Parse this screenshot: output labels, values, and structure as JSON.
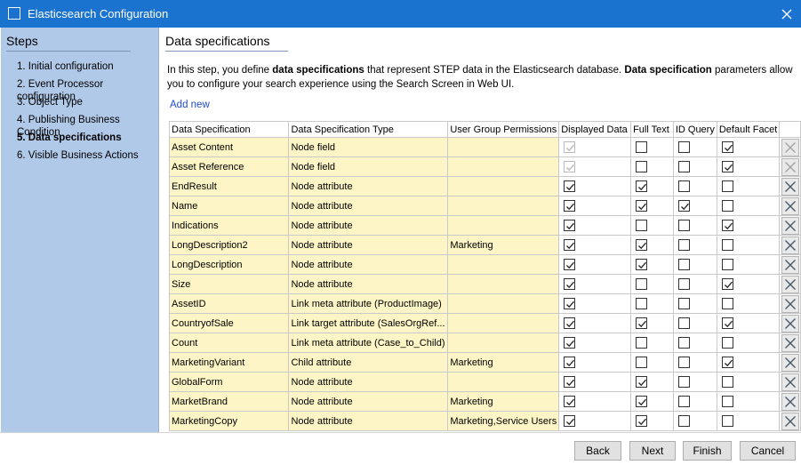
{
  "window": {
    "title": "Elasticsearch Configuration"
  },
  "sidebar": {
    "heading": "Steps",
    "items": [
      {
        "label": "1. Initial configuration",
        "active": false
      },
      {
        "label": "2. Event Processor configuration",
        "active": false
      },
      {
        "label": "3. Object Type",
        "active": false
      },
      {
        "label": "4. Publishing Business Condition",
        "active": false
      },
      {
        "label": "5. Data specifications",
        "active": true
      },
      {
        "label": "6. Visible Business Actions",
        "active": false
      }
    ]
  },
  "main": {
    "heading": "Data specifications",
    "intro": {
      "p1": "In this step, you define ",
      "b1": "data specifications",
      "p2": " that represent STEP data in the Elasticsearch database. ",
      "b2": "Data specification",
      "p3": " parameters allow you to configure your search experience using the Search Screen in Web UI."
    },
    "add_new": "Add new"
  },
  "table": {
    "columns": [
      "Data Specification",
      "Data Specification Type",
      "User Group Permissions",
      "Displayed Data",
      "Full Text",
      "ID Query",
      "Default Facet"
    ],
    "rows": [
      {
        "spec": "Asset Content",
        "type": "Node field",
        "perm": "",
        "displayed": true,
        "fulltext": false,
        "idquery": false,
        "facet": true,
        "locked": true
      },
      {
        "spec": "Asset Reference",
        "type": "Node field",
        "perm": "",
        "displayed": true,
        "fulltext": false,
        "idquery": false,
        "facet": true,
        "locked": true
      },
      {
        "spec": "EndResult",
        "type": "Node attribute",
        "perm": "",
        "displayed": true,
        "fulltext": true,
        "idquery": false,
        "facet": false,
        "locked": false
      },
      {
        "spec": "Name",
        "type": "Node attribute",
        "perm": "",
        "displayed": true,
        "fulltext": true,
        "idquery": true,
        "facet": false,
        "locked": false
      },
      {
        "spec": "Indications",
        "type": "Node attribute",
        "perm": "",
        "displayed": true,
        "fulltext": false,
        "idquery": false,
        "facet": true,
        "locked": false
      },
      {
        "spec": "LongDescription2",
        "type": "Node attribute",
        "perm": "Marketing",
        "displayed": true,
        "fulltext": true,
        "idquery": false,
        "facet": false,
        "locked": false
      },
      {
        "spec": "LongDescription",
        "type": "Node attribute",
        "perm": "",
        "displayed": true,
        "fulltext": true,
        "idquery": false,
        "facet": false,
        "locked": false
      },
      {
        "spec": "Size",
        "type": "Node attribute",
        "perm": "",
        "displayed": true,
        "fulltext": false,
        "idquery": false,
        "facet": true,
        "locked": false
      },
      {
        "spec": "AssetID",
        "type": "Link meta attribute (ProductImage)",
        "perm": "",
        "displayed": true,
        "fulltext": false,
        "idquery": false,
        "facet": false,
        "locked": false
      },
      {
        "spec": "CountryofSale",
        "type": "Link target attribute (SalesOrgRef...",
        "perm": "",
        "displayed": true,
        "fulltext": true,
        "idquery": false,
        "facet": true,
        "locked": false
      },
      {
        "spec": "Count",
        "type": "Link meta attribute (Case_to_Child)",
        "perm": "",
        "displayed": true,
        "fulltext": false,
        "idquery": false,
        "facet": false,
        "locked": false
      },
      {
        "spec": "MarketingVariant",
        "type": "Child attribute",
        "perm": "Marketing",
        "displayed": true,
        "fulltext": false,
        "idquery": false,
        "facet": true,
        "locked": false
      },
      {
        "spec": "GlobalForm",
        "type": "Node attribute",
        "perm": "",
        "displayed": true,
        "fulltext": true,
        "idquery": false,
        "facet": false,
        "locked": false
      },
      {
        "spec": "MarketBrand",
        "type": "Node attribute",
        "perm": "Marketing",
        "displayed": true,
        "fulltext": true,
        "idquery": false,
        "facet": false,
        "locked": false
      },
      {
        "spec": "MarketingCopy",
        "type": "Node attribute",
        "perm": "Marketing,Service Users",
        "displayed": true,
        "fulltext": true,
        "idquery": false,
        "facet": false,
        "locked": false
      }
    ]
  },
  "buttons": {
    "back": "Back",
    "next": "Next",
    "finish": "Finish",
    "cancel": "Cancel"
  },
  "icons": {
    "app": "window-icon",
    "close": "close-icon",
    "delete": "delete-icon",
    "check": "checkmark-icon"
  },
  "colors": {
    "titlebar": "#1a73cf",
    "sidebar": "#b0c9e8",
    "editable_cell": "#fdf5c5",
    "link": "#1f4bd4"
  }
}
